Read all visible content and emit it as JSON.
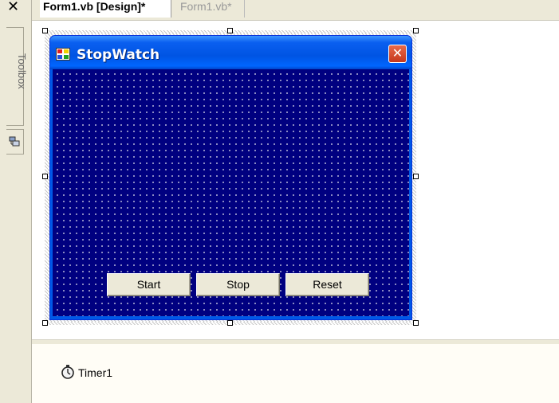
{
  "toolbox": {
    "label": "Toolbox",
    "close_glyph": "✕",
    "servers_icon": "server-explorer-icon"
  },
  "tabs": [
    {
      "label": "Form1.vb [Design]*",
      "active": true
    },
    {
      "label": "Form1.vb*",
      "active": false
    }
  ],
  "form": {
    "title": "StopWatch",
    "icon": "form-icon",
    "close_glyph": "✕",
    "back_color": "#000080",
    "buttons": [
      {
        "label": "Start"
      },
      {
        "label": "Stop"
      },
      {
        "label": "Reset"
      }
    ]
  },
  "tray": {
    "components": [
      {
        "label": "Timer1",
        "icon": "stopwatch-icon"
      }
    ]
  }
}
